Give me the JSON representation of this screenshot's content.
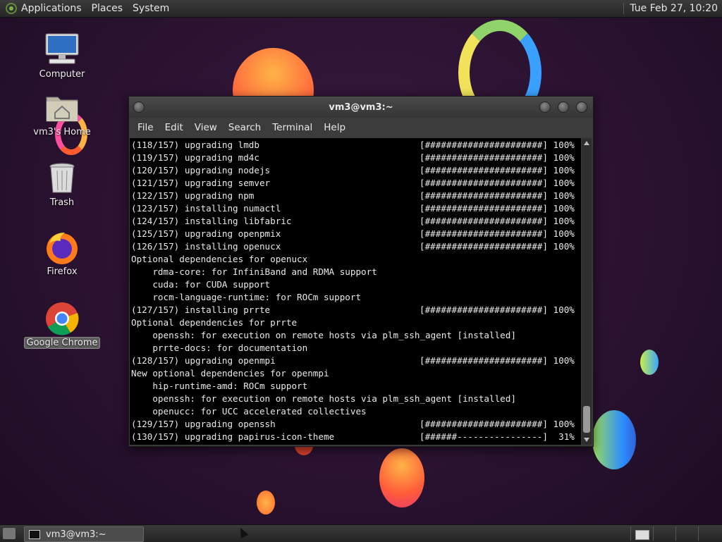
{
  "top_panel": {
    "menus": [
      "Applications",
      "Places",
      "System"
    ],
    "clock": "Tue Feb 27, 10:20"
  },
  "desktop_icons": [
    {
      "label": "Computer",
      "icon": "computer-icon"
    },
    {
      "label": "vm3's Home",
      "icon": "home-folder-icon"
    },
    {
      "label": "Trash",
      "icon": "trash-icon"
    },
    {
      "label": "Firefox",
      "icon": "firefox-icon"
    },
    {
      "label": "Google Chrome",
      "icon": "chrome-icon",
      "selected": true
    }
  ],
  "window": {
    "title": "vm3@vm3:~",
    "menu": [
      "File",
      "Edit",
      "View",
      "Search",
      "Terminal",
      "Help"
    ]
  },
  "terminal_lines": [
    {
      "text": "(118/157) upgrading lmdb",
      "progress": "[######################] 100%"
    },
    {
      "text": "(119/157) upgrading md4c",
      "progress": "[######################] 100%"
    },
    {
      "text": "(120/157) upgrading nodejs",
      "progress": "[######################] 100%"
    },
    {
      "text": "(121/157) upgrading semver",
      "progress": "[######################] 100%"
    },
    {
      "text": "(122/157) upgrading npm",
      "progress": "[######################] 100%"
    },
    {
      "text": "(123/157) installing numactl",
      "progress": "[######################] 100%"
    },
    {
      "text": "(124/157) installing libfabric",
      "progress": "[######################] 100%"
    },
    {
      "text": "(125/157) upgrading openpmix",
      "progress": "[######################] 100%"
    },
    {
      "text": "(126/157) installing openucx",
      "progress": "[######################] 100%"
    },
    {
      "text": "Optional dependencies for openucx",
      "progress": ""
    },
    {
      "text": "    rdma-core: for InfiniBand and RDMA support",
      "progress": ""
    },
    {
      "text": "    cuda: for CUDA support",
      "progress": ""
    },
    {
      "text": "    rocm-language-runtime: for ROCm support",
      "progress": ""
    },
    {
      "text": "(127/157) installing prrte",
      "progress": "[######################] 100%"
    },
    {
      "text": "Optional dependencies for prrte",
      "progress": ""
    },
    {
      "text": "    openssh: for execution on remote hosts via plm_ssh_agent [installed]",
      "progress": ""
    },
    {
      "text": "    prrte-docs: for documentation",
      "progress": ""
    },
    {
      "text": "(128/157) upgrading openmpi",
      "progress": "[######################] 100%"
    },
    {
      "text": "New optional dependencies for openmpi",
      "progress": ""
    },
    {
      "text": "    hip-runtime-amd: ROCm support",
      "progress": ""
    },
    {
      "text": "    openssh: for execution on remote hosts via plm_ssh_agent [installed]",
      "progress": ""
    },
    {
      "text": "    openucc: for UCC accelerated collectives",
      "progress": ""
    },
    {
      "text": "(129/157) upgrading openssh",
      "progress": "[######################] 100%"
    },
    {
      "text": "(130/157) upgrading papirus-icon-theme",
      "progress": "[######----------------]  31%"
    }
  ],
  "taskbar": {
    "task_label": "vm3@vm3:~"
  }
}
